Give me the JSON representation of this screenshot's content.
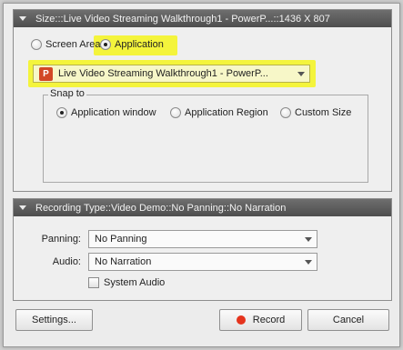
{
  "size_section": {
    "header": "Size:::Live Video Streaming Walkthrough1 - PowerP...::1436 X 807",
    "screen_area_label": "Screen Area",
    "application_label": "Application",
    "selected_mode": "Application",
    "app_select_value": "Live Video Streaming Walkthrough1 - PowerP...",
    "app_icon_letter": "P",
    "highlight_color": "#f4f43c",
    "snap_to": {
      "legend": "Snap to",
      "options": [
        "Application window",
        "Application Region",
        "Custom Size"
      ],
      "selected": "Application window"
    }
  },
  "recording_section": {
    "header": "Recording Type::Video Demo::No Panning::No Narration",
    "panning_label": "Panning:",
    "panning_value": "No Panning",
    "audio_label": "Audio:",
    "audio_value": "No Narration",
    "system_audio_label": "System Audio",
    "system_audio_checked": false
  },
  "buttons": {
    "settings": "Settings...",
    "record": "Record",
    "cancel": "Cancel"
  },
  "colors": {
    "record_dot": "#e5341d",
    "header_bg": "#5a5a5a",
    "ppt_icon": "#d24726"
  }
}
